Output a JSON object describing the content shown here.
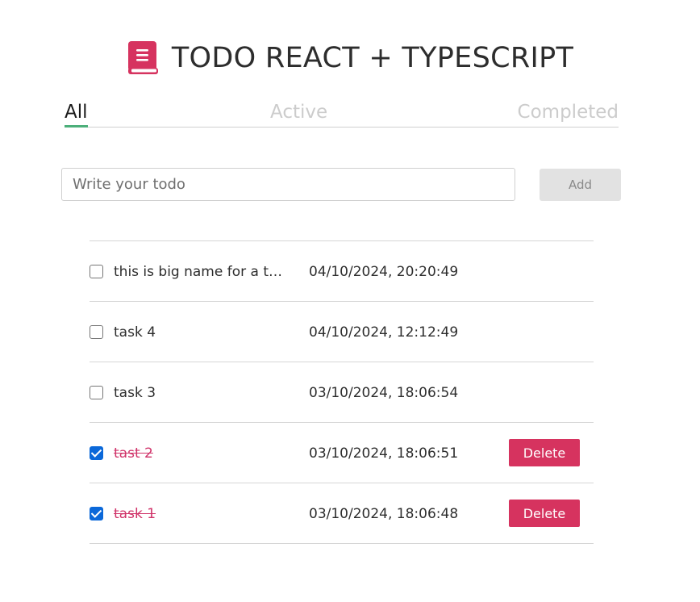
{
  "app": {
    "title": "TODO REACT + TYPESCRIPT",
    "icon": "book-icon",
    "accent_color": "#d6335f"
  },
  "tabs": [
    {
      "label": "All",
      "selected": true
    },
    {
      "label": "Active",
      "selected": false
    },
    {
      "label": "Completed",
      "selected": false
    }
  ],
  "input": {
    "value": "",
    "placeholder": "Write your todo"
  },
  "add_button": {
    "label": "Add",
    "enabled": false
  },
  "delete_label": "Delete",
  "todos": [
    {
      "name": "this is big name for a task",
      "date": "04/10/2024, 20:20:49",
      "completed": false
    },
    {
      "name": "task 4",
      "date": "04/10/2024, 12:12:49",
      "completed": false
    },
    {
      "name": "task 3",
      "date": "03/10/2024, 18:06:54",
      "completed": false
    },
    {
      "name": "tast 2",
      "date": "03/10/2024, 18:06:51",
      "completed": true
    },
    {
      "name": "task 1",
      "date": "03/10/2024, 18:06:48",
      "completed": true
    }
  ]
}
